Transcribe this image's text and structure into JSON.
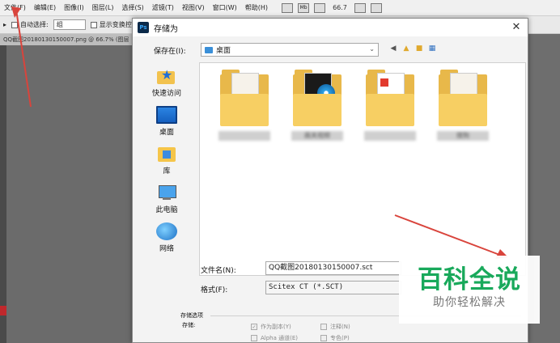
{
  "ps": {
    "menu": [
      "文件(F)",
      "编辑(E)",
      "图像(I)",
      "图层(L)",
      "选择(S)",
      "滤镜(T)",
      "视图(V)",
      "窗口(W)",
      "帮助(H)"
    ],
    "zoom": "66.7",
    "tool_labels": [
      "Mb"
    ],
    "options": {
      "auto_select_label": "自动选择:",
      "group_value": "组",
      "show_transform_label": "显示变换控"
    },
    "doc_tab": "QQ截图20180130150007.png @ 66.7% (图层"
  },
  "dialog": {
    "logo": "Ps",
    "title": "存储为",
    "close": "✕",
    "save_in_label": "保存在(I):",
    "save_in_value": "桌面",
    "places": [
      {
        "label": "快速访问",
        "icon": "quick-access-star"
      },
      {
        "label": "桌面",
        "icon": "desktop"
      },
      {
        "label": "库",
        "icon": "library"
      },
      {
        "label": "此电脑",
        "icon": "computer"
      },
      {
        "label": "网络",
        "icon": "network"
      }
    ],
    "files": [
      {
        "label": "",
        "kind": "folder-docs"
      },
      {
        "label": "画关视频",
        "kind": "folder-video"
      },
      {
        "label": "",
        "kind": "folder-pdf"
      },
      {
        "label": "搜狗",
        "kind": "folder-docs"
      }
    ],
    "filename_label": "文件名(N):",
    "filename_value": "QQ截图20180130150007.sct",
    "format_label": "格式(F):",
    "format_value": "Scitex CT (*.SCT)",
    "options": {
      "group_title": "存储选项",
      "save_label": "存储:",
      "as_copy": "作为副本(Y)",
      "notes": "注释(N)",
      "alpha": "Alpha 通道(E)",
      "spot": "专色(P)"
    }
  },
  "watermark": {
    "title": "百科全说",
    "subtitle": "助你轻松解决"
  },
  "colors": {
    "annotation_arrow": "#d9443c",
    "watermark_green": "#19a95b"
  }
}
